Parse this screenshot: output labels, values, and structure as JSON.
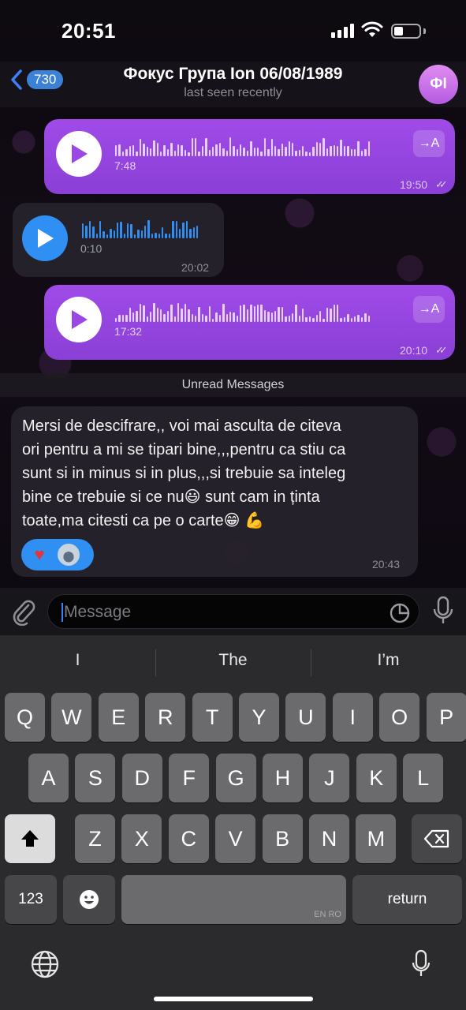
{
  "status_bar": {
    "time": "20:51"
  },
  "header": {
    "back_count": "730",
    "title": "Фокус Група Ion 06/08/1989",
    "subtitle": "last seen recently",
    "avatar_initials": "ФI"
  },
  "messages": [
    {
      "type": "voice",
      "direction": "outgoing",
      "duration": "7:48",
      "time": "19:50",
      "read": true,
      "transcribe_label": "→A"
    },
    {
      "type": "voice",
      "direction": "incoming",
      "duration": "0:10",
      "time": "20:02"
    },
    {
      "type": "voice",
      "direction": "outgoing",
      "duration": "17:32",
      "time": "20:10",
      "read": true,
      "transcribe_label": "→A"
    }
  ],
  "unread_divider": "Unread Messages",
  "text_message": {
    "lines": [
      "Mersi de descifrare,, voi mai asculta de citeva",
      "ori pentru a mi se tipari bine,,,pentru ca stiu ca",
      "sunt si in minus si in plus,,,si trebuie sa inteleg",
      "bine ce trebuie si ce nu😃  sunt cam in ținta",
      "toate,ma citesti ca pe o carte😁 💪"
    ],
    "time": "20:43",
    "reaction": "❤️"
  },
  "input": {
    "placeholder": "Message"
  },
  "keyboard": {
    "suggestions": [
      "I",
      "The",
      "I’m"
    ],
    "row1": [
      "Q",
      "W",
      "E",
      "R",
      "T",
      "Y",
      "U",
      "I",
      "O",
      "P"
    ],
    "row2": [
      "A",
      "S",
      "D",
      "F",
      "G",
      "H",
      "J",
      "K",
      "L"
    ],
    "row3": [
      "Z",
      "X",
      "C",
      "V",
      "B",
      "N",
      "M"
    ],
    "numbers_label": "123",
    "return_label": "return",
    "space_hint": "EN RO"
  },
  "colors": {
    "outgoing_bubble": "#9b47e6",
    "accent_blue": "#2f8ff2",
    "avatar": "#c970ea"
  }
}
